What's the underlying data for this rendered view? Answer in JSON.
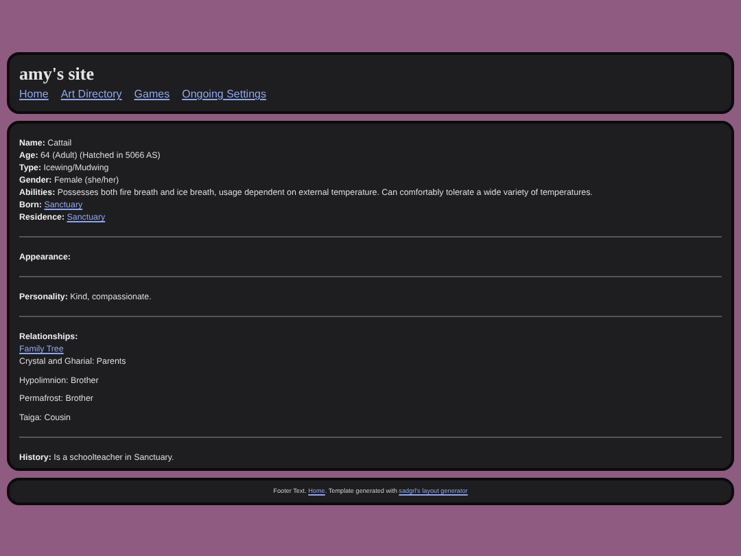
{
  "header": {
    "title": "amy's site",
    "nav": [
      {
        "label": "Home"
      },
      {
        "label": "Art Directory"
      },
      {
        "label": "Games"
      },
      {
        "label": "Ongoing Settings"
      }
    ]
  },
  "sections": [
    {
      "items": [
        {
          "kind": "field",
          "label": "Name:",
          "text": "Cattail"
        },
        {
          "kind": "field",
          "label": "Age:",
          "text": "64 (Adult) (Hatched in 5066 AS)"
        },
        {
          "kind": "field",
          "label": "Type:",
          "text": "Icewing/Mudwing"
        },
        {
          "kind": "field",
          "label": "Gender:",
          "text": "Female (she/her)"
        },
        {
          "kind": "field",
          "label": "Abilities:",
          "text": "Possesses both fire breath and ice breath, usage dependent on external temperature. Can comfortably tolerate a wide variety of temperatures."
        },
        {
          "kind": "link-field",
          "label": "Born:",
          "text": "Sanctuary"
        },
        {
          "kind": "link-field",
          "label": "Residence:",
          "text": "Sanctuary"
        }
      ]
    },
    {
      "items": [
        {
          "kind": "field",
          "label": "Appearance:"
        }
      ]
    },
    {
      "items": [
        {
          "kind": "field",
          "label": "Personality:",
          "text": "Kind, compassionate."
        }
      ]
    },
    {
      "items": [
        {
          "kind": "field",
          "label": "Relationships:"
        },
        {
          "kind": "link",
          "text": "Family Tree"
        },
        {
          "kind": "line",
          "text": "Crystal and Gharial: Parents"
        },
        {
          "kind": "para",
          "text": "Hypolimnion: Brother"
        },
        {
          "kind": "para",
          "text": "Permafrost: Brother"
        },
        {
          "kind": "para",
          "text": "Taiga: Cousin"
        }
      ]
    },
    {
      "items": [
        {
          "kind": "field",
          "label": "History:",
          "text": "Is a schoolteacher in Sanctuary."
        }
      ]
    }
  ],
  "footer": {
    "text": "Footer Text.",
    "link": "Home",
    "text_2": ". Template generated with",
    "credit_link": "sadgrl's layout generator"
  }
}
